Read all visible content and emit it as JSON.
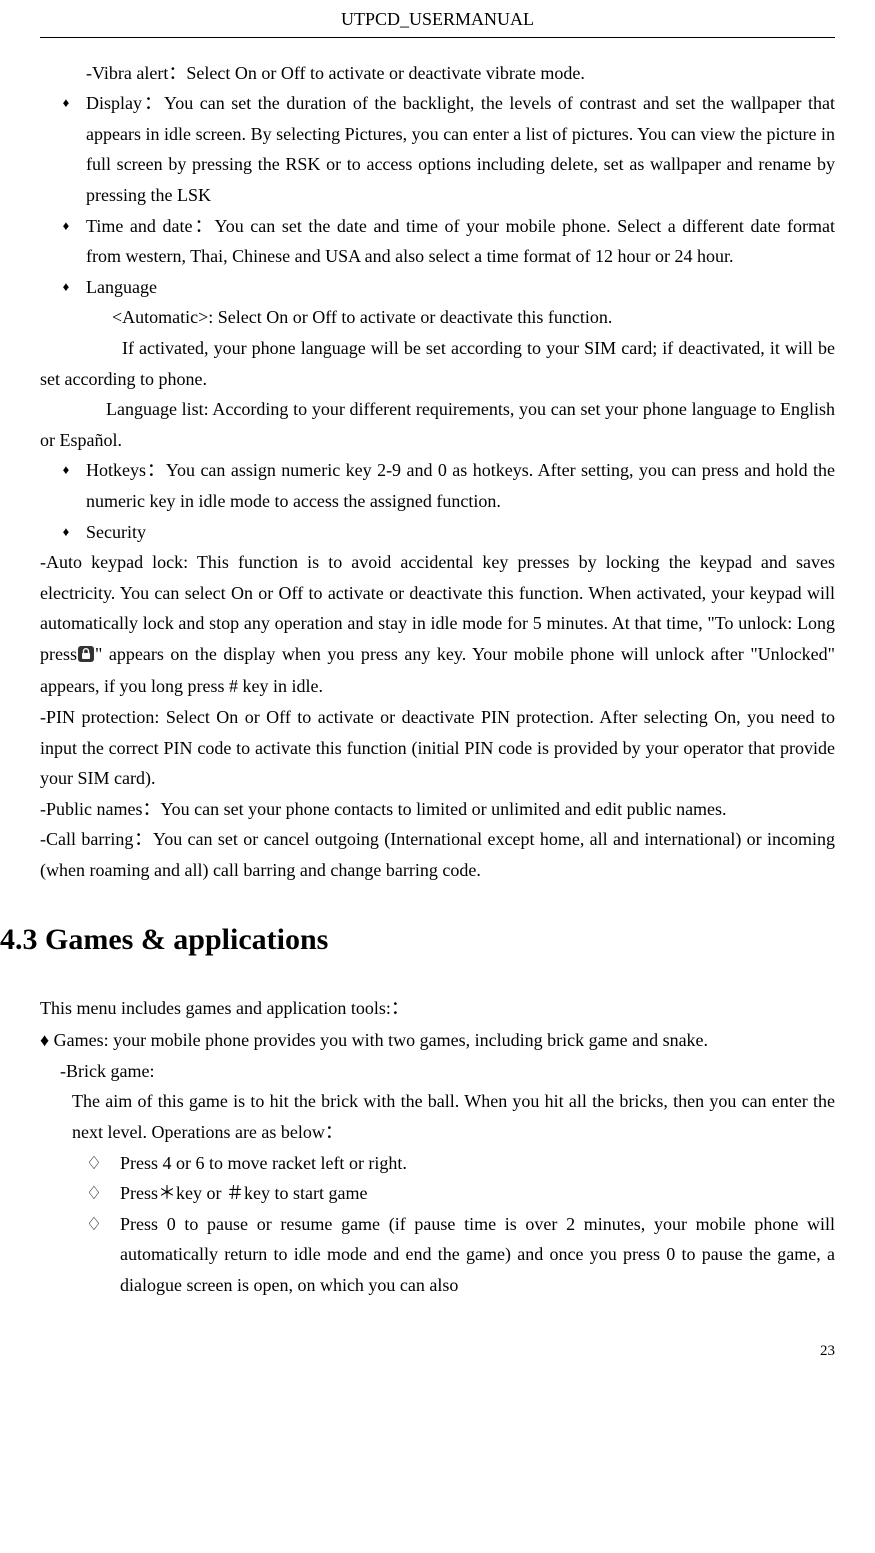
{
  "header": "UTPCD_USERMANUAL",
  "vibra": "-Vibra alert：Select On or Off to activate or deactivate vibrate mode.",
  "display": "Display：You can set the duration of the backlight, the levels of contrast and set the wallpaper that appears in idle screen. By selecting Pictures, you can enter a list of pictures. You can view the picture in full screen by pressing the RSK or to access options including delete, set as wallpaper and rename by pressing the LSK",
  "timedate": "Time and date：You can set the date and time of your mobile phone. Select a different date format from western, Thai, Chinese and USA and also select a time format of 12 hour or 24 hour.",
  "language_label": "Language",
  "language_auto": "<Automatic>: Select On or Off to activate or deactivate this function.",
  "language_auto_desc": "If activated, your phone language will be set according to your SIM card; if deactivated, it will be set according to phone.",
  "language_list": "Language list: According to your different requirements, you can set your phone language to English or Español.",
  "hotkeys": "Hotkeys：You can assign numeric key 2-9 and 0 as hotkeys. After setting, you can press and hold the numeric key in idle mode to access the assigned function.",
  "security_label": "Security",
  "sec_pre": "-Auto keypad lock: This function is to avoid accidental key presses by locking the keypad and saves electricity. You can select On or Off to activate or deactivate this function. When activated, your keypad will automatically lock and stop any operation and stay in idle mode for 5 minutes. At that time, \"To unlock: Long press",
  "sec_post": "\" appears on the display when you press any key. Your mobile phone will unlock after \"Unlocked\" appears, if you long press # key in idle.",
  "pin": "-PIN protection: Select On or Off to activate or deactivate PIN protection. After selecting On, you need to input the correct PIN code to activate this function (initial PIN code is provided by your operator that provide your SIM card).",
  "public_names": "-Public names：You can set your phone contacts to limited or unlimited and edit public names.",
  "call_barring": "-Call barring：You can set or cancel outgoing (International except home, all and international) or incoming (when roaming and all) call barring and change barring code.",
  "section_heading": "4.3 Games & applications",
  "games_intro": "This menu includes games and application tools:：",
  "games_bullet": "♦ Games: your mobile phone provides you with two games, including brick game and snake.",
  "brick_header": "-Brick game:",
  "brick_body": "The aim of this game is to hit the brick with the ball. When you hit all the bricks, then you can enter the next level. Operations are as below：",
  "d1": "Press 4 or 6 to move racket left or right.",
  "d2": "Press＊key or ＃key to start game",
  "d3": "Press 0 to pause or resume game (if pause time is over 2 minutes, your mobile phone will automatically return to idle mode and end the game) and once you press 0 to pause the game, a dialogue screen is open, on which you can also",
  "page_number": "23"
}
